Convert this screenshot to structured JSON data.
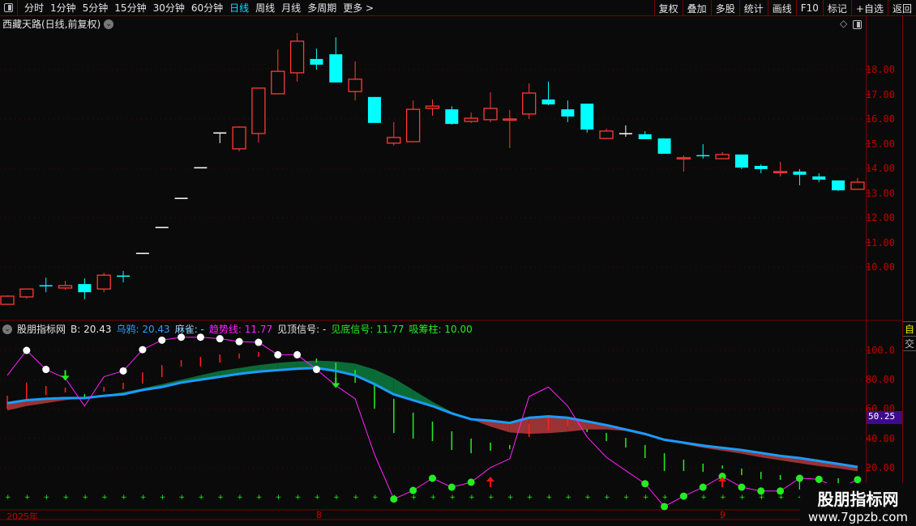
{
  "toolbar": {
    "tabs": [
      "分时",
      "1分钟",
      "5分钟",
      "15分钟",
      "30分钟",
      "60分钟",
      "日线",
      "周线",
      "月线",
      "多周期",
      "更多 >"
    ],
    "active": "日线",
    "right_buttons": [
      "复权",
      "叠加",
      "多股",
      "统计",
      "画线",
      "F10",
      "标记",
      "+自选",
      "返回"
    ]
  },
  "title": "西藏天路(日线,前复权)",
  "indicator": {
    "name": "股朋指标网",
    "items": [
      {
        "label": "B: 20.43",
        "color": "#e6e6e6"
      },
      {
        "label": "乌鸦: 20.43",
        "color": "#2f9bff"
      },
      {
        "label": "麻雀: -",
        "color": "#8fd0ff"
      },
      {
        "label": "趋势线: 11.77",
        "color": "#ff22ff"
      },
      {
        "label": "见顶信号: -",
        "color": "#e6e6e6"
      },
      {
        "label": "见底信号: 11.77",
        "color": "#22ee22"
      },
      {
        "label": "吸筹柱: 10.00",
        "color": "#22ee22"
      }
    ]
  },
  "price_axis": [
    "18.00",
    "17.00",
    "16.00",
    "15.00",
    "14.00",
    "13.00",
    "12.00",
    "11.00",
    "10.00"
  ],
  "lower_axis": [
    "100.0",
    "80.00",
    "60.00",
    "40.00",
    "20.00"
  ],
  "current_value": "50.25",
  "dates": [
    "2025年",
    "8",
    "9"
  ],
  "side_labels": [
    "自",
    "交"
  ],
  "watermark": {
    "name": "股朋指标网",
    "url": "www.7gpzb.com"
  },
  "chart_data": {
    "type": "candlestick",
    "colors": {
      "r": "#ff3a3a",
      "c": "#00ffff",
      "w": "#ffffff",
      "g": "#22ee22"
    },
    "candles": [
      [
        8.49,
        8.85,
        8.49,
        8.82,
        "r"
      ],
      [
        8.79,
        9.11,
        8.72,
        9.11,
        "r"
      ],
      [
        9.25,
        9.57,
        8.98,
        9.25,
        "c"
      ],
      [
        9.15,
        9.44,
        9.08,
        9.25,
        "r"
      ],
      [
        9.31,
        9.54,
        8.69,
        8.98,
        "c"
      ],
      [
        9.11,
        9.77,
        8.98,
        9.67,
        "r"
      ],
      [
        9.64,
        9.84,
        9.38,
        9.64,
        "c"
      ],
      [
        10.56,
        10.56,
        10.56,
        10.56,
        "w"
      ],
      [
        11.61,
        11.61,
        11.61,
        11.61,
        "w"
      ],
      [
        12.79,
        12.79,
        12.79,
        12.79,
        "w"
      ],
      [
        14.03,
        14.03,
        14.03,
        14.03,
        "w"
      ],
      [
        15.44,
        15.44,
        15.02,
        15.44,
        "w"
      ],
      [
        14.79,
        15.7,
        14.69,
        15.67,
        "r"
      ],
      [
        15.41,
        17.25,
        15.05,
        17.25,
        "r"
      ],
      [
        17.02,
        18.82,
        17.02,
        17.93,
        "r"
      ],
      [
        17.87,
        19.48,
        17.51,
        19.15,
        "r"
      ],
      [
        18.43,
        18.85,
        18.0,
        18.2,
        "c"
      ],
      [
        18.62,
        19.31,
        17.48,
        17.48,
        "c"
      ],
      [
        17.11,
        18.33,
        16.75,
        17.61,
        "r"
      ],
      [
        16.89,
        16.89,
        15.84,
        15.84,
        "c"
      ],
      [
        15.02,
        15.87,
        14.92,
        15.25,
        "r"
      ],
      [
        15.08,
        16.75,
        15.08,
        16.39,
        "r"
      ],
      [
        16.43,
        16.79,
        16.13,
        16.52,
        "r"
      ],
      [
        16.39,
        16.52,
        15.77,
        15.8,
        "c"
      ],
      [
        15.9,
        16.26,
        15.84,
        16.03,
        "r"
      ],
      [
        15.97,
        17.08,
        15.87,
        16.43,
        "r"
      ],
      [
        16.0,
        16.36,
        14.82,
        16.0,
        "r"
      ],
      [
        16.2,
        17.44,
        16.0,
        17.05,
        "r"
      ],
      [
        16.79,
        17.51,
        16.56,
        16.59,
        "c"
      ],
      [
        16.39,
        16.75,
        15.87,
        16.1,
        "c"
      ],
      [
        16.62,
        16.62,
        15.44,
        15.57,
        "c"
      ],
      [
        15.21,
        15.61,
        15.18,
        15.51,
        "r"
      ],
      [
        15.41,
        15.74,
        15.28,
        15.41,
        "w"
      ],
      [
        15.38,
        15.51,
        15.18,
        15.18,
        "c"
      ],
      [
        15.21,
        15.21,
        14.59,
        14.59,
        "c"
      ],
      [
        14.43,
        14.52,
        13.87,
        14.43,
        "r"
      ],
      [
        14.52,
        14.98,
        14.39,
        14.52,
        "c"
      ],
      [
        14.39,
        14.66,
        14.39,
        14.56,
        "r"
      ],
      [
        14.56,
        14.56,
        13.97,
        14.03,
        "c"
      ],
      [
        14.1,
        14.16,
        13.8,
        13.97,
        "c"
      ],
      [
        13.87,
        14.26,
        13.67,
        13.87,
        "r"
      ],
      [
        13.87,
        13.97,
        13.31,
        13.74,
        "c"
      ],
      [
        13.67,
        13.8,
        13.44,
        13.54,
        "c"
      ],
      [
        13.51,
        13.51,
        13.08,
        13.11,
        "c"
      ],
      [
        13.15,
        13.61,
        13.15,
        13.44,
        "r"
      ]
    ],
    "crow": [
      64,
      66,
      67,
      67.5,
      67.5,
      69,
      70,
      73,
      75,
      78,
      80,
      82,
      84,
      85.5,
      86.5,
      87.5,
      88,
      86,
      83,
      77,
      70,
      66,
      62,
      57,
      53,
      52,
      50.5,
      54,
      55,
      54,
      51.5,
      49,
      46,
      43,
      39,
      37,
      35,
      33.5,
      32,
      30,
      28,
      26.5,
      24.5,
      22.5,
      20.43
    ],
    "ribbon": [
      59,
      62,
      64,
      66,
      67.5,
      69.5,
      71.5,
      74,
      77,
      80,
      83,
      86,
      88,
      90,
      91.5,
      92.5,
      93,
      92.5,
      91,
      87,
      81,
      73,
      65,
      58,
      53,
      48,
      44,
      43,
      43.5,
      44.5,
      46,
      46,
      45,
      42,
      39.5,
      36,
      33.5,
      31.5,
      29.5,
      27,
      25,
      23,
      21,
      19.5,
      17.5
    ],
    "trend": [
      83,
      100,
      87,
      81,
      62,
      82,
      86,
      100.5,
      107,
      109,
      109,
      108,
      106,
      105.5,
      97,
      97,
      87,
      76,
      67,
      29,
      -1.5,
      4.4,
      12.7,
      6.6,
      10,
      20,
      26,
      68.5,
      75,
      62,
      41,
      27,
      18,
      9,
      -6.6,
      0.5,
      6.6,
      14,
      6.6,
      4,
      4,
      12.7,
      12,
      5.5,
      11.77
    ],
    "bars": [
      [
        0,
        69,
        60.2,
        "r"
      ],
      [
        1,
        78,
        65.7,
        "r"
      ],
      [
        2,
        75.7,
        69.6,
        "r"
      ],
      [
        3,
        74.6,
        71.3,
        "r"
      ],
      [
        4,
        70.2,
        66.9,
        "g"
      ],
      [
        5,
        75.1,
        71.8,
        "r"
      ],
      [
        6,
        77.9,
        73.5,
        "r"
      ],
      [
        7,
        85,
        77.3,
        "r"
      ],
      [
        8,
        90,
        81.8,
        "r"
      ],
      [
        9,
        93.4,
        89,
        "r"
      ],
      [
        10,
        95.6,
        89,
        "r"
      ],
      [
        11,
        97.2,
        91.7,
        "r"
      ],
      [
        12,
        97.8,
        94.5,
        "r"
      ],
      [
        13,
        98.9,
        95.6,
        "r"
      ],
      [
        14,
        97,
        96,
        "r"
      ],
      [
        16,
        94.5,
        91.7,
        "g"
      ],
      [
        17,
        91.7,
        77.9,
        "g"
      ],
      [
        18,
        86.7,
        77.9,
        "g"
      ],
      [
        19,
        77.9,
        60.2,
        "g"
      ],
      [
        20,
        66.9,
        43.6,
        "g"
      ],
      [
        21,
        57.5,
        39.8,
        "g"
      ],
      [
        22,
        51.4,
        38.1,
        "g"
      ],
      [
        23,
        44.8,
        32,
        "g"
      ],
      [
        24,
        39.8,
        29.8,
        "g"
      ],
      [
        25,
        37,
        31.5,
        "g"
      ],
      [
        26,
        35.4,
        32.6,
        "g"
      ],
      [
        27,
        49.7,
        40.9,
        "r"
      ],
      [
        28,
        55.8,
        45.3,
        "r"
      ],
      [
        29,
        53,
        48,
        "r"
      ],
      [
        30,
        46.4,
        44.2,
        "g"
      ],
      [
        31,
        43.6,
        38.1,
        "g"
      ],
      [
        32,
        40.3,
        33.7,
        "g"
      ],
      [
        33,
        35.4,
        26.5,
        "g"
      ],
      [
        34,
        29.8,
        17.7,
        "g"
      ],
      [
        35,
        25.4,
        17.7,
        "g"
      ],
      [
        36,
        22.7,
        17.1,
        "g"
      ],
      [
        37,
        21.5,
        19.3,
        "g"
      ],
      [
        38,
        19.3,
        14.9,
        "g"
      ],
      [
        39,
        17.1,
        12.2,
        "g"
      ],
      [
        40,
        14.9,
        11.6,
        "g"
      ],
      [
        41,
        10.5,
        5,
        "g"
      ],
      [
        42,
        10.5,
        7.7,
        "g"
      ],
      [
        43,
        12.7,
        8.8,
        "g"
      ]
    ],
    "sell_arrows": [
      3,
      17
    ],
    "buy_arrows": [
      25,
      37
    ],
    "top_threshold": 85,
    "bottom_threshold": 15
  }
}
